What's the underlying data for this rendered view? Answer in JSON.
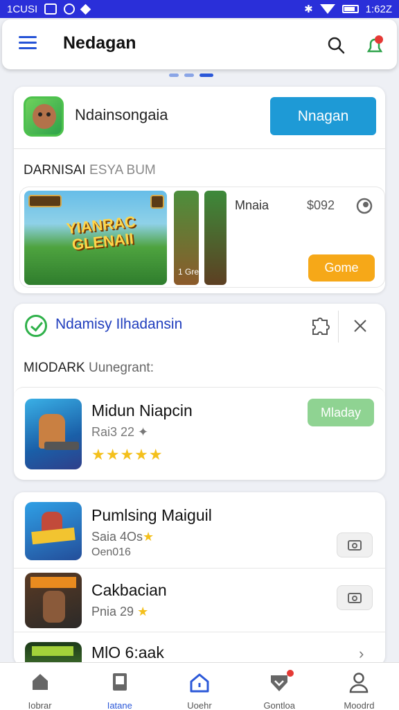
{
  "status_bar": {
    "left_text": "1CUSI",
    "time": "1:62Z"
  },
  "header": {
    "title": "Nedagan"
  },
  "card1": {
    "app_name": "Ndainsongaia",
    "button_label": "Nnagan",
    "section_bold": "DARNISAI",
    "section_light": "ESYA BUM",
    "screenshot_logo_line1": "YIANRAC",
    "screenshot_logo_line2": "GLENAII",
    "screenshot_tag": "1 Gre",
    "sub_name": "Mnaia",
    "price": "$092",
    "game_button": "Gome"
  },
  "card2": {
    "title": "Ndamisy Ilhadansin",
    "section_bold": "MIODARK",
    "section_light": "Uunegrant:",
    "app_name": "Midun Niapcin",
    "meta": "Rai3 22 ✦",
    "rating": 5,
    "stars": "★★★★★",
    "install_label": "Mladay"
  },
  "card3": {
    "rows": [
      {
        "name": "Pumlsing Maiguil",
        "meta": "Saia 4Os",
        "sub": "Oen016"
      },
      {
        "name": "Cakbacian",
        "meta": "Pnia 29"
      },
      {
        "name": "MlO 6:aak"
      }
    ]
  },
  "bottom_nav": [
    {
      "label": "Iobrar",
      "icon": "home-icon"
    },
    {
      "label": "Iatane",
      "icon": "book-icon"
    },
    {
      "label": "Uoehr",
      "icon": "house-outline-icon"
    },
    {
      "label": "Gontloa",
      "icon": "shield-icon"
    },
    {
      "label": "Moodrd",
      "icon": "person-icon"
    }
  ],
  "colors": {
    "accent": "#2b58d8",
    "primary_button": "#1e9ad6",
    "game_button": "#f6a818",
    "install_button": "#8fd392",
    "status_bar": "#2a2fd9"
  }
}
